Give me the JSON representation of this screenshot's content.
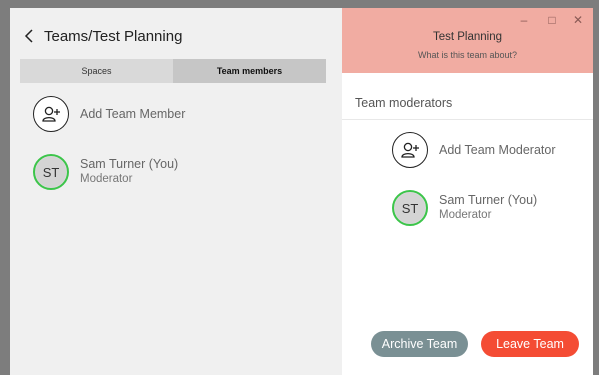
{
  "left_panel": {
    "breadcrumb": "Teams/Test Planning",
    "tabs": [
      {
        "label": "Spaces",
        "active": false
      },
      {
        "label": "Team members",
        "active": true
      }
    ],
    "add_member_label": "Add Team Member",
    "members": [
      {
        "initials": "ST",
        "name": "Sam Turner (You)",
        "role": "Moderator"
      }
    ]
  },
  "right_panel": {
    "team_name": "Test Planning",
    "team_description": "What is this team about?",
    "section_title": "Team moderators",
    "add_moderator_label": "Add Team Moderator",
    "moderators": [
      {
        "initials": "ST",
        "name": "Sam Turner (You)",
        "role": "Moderator"
      }
    ],
    "archive_button": "Archive Team",
    "leave_button": "Leave Team"
  },
  "window_controls": {
    "minimize": "–",
    "maximize": "□",
    "close": "✕"
  },
  "colors": {
    "header_bg": "#f1aca2",
    "leave_button": "#f44c34",
    "archive_button": "#7a9094",
    "avatar_ring": "#3cc54a"
  }
}
